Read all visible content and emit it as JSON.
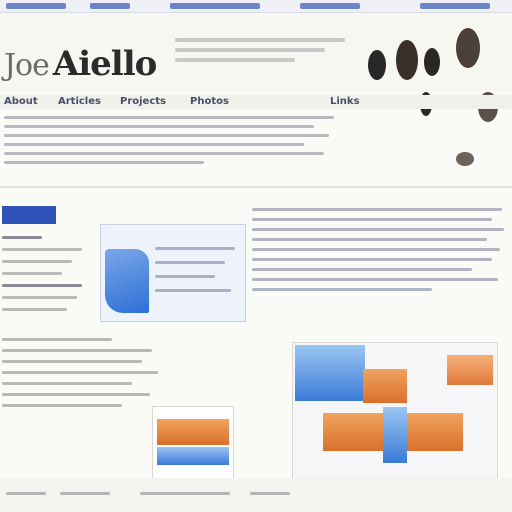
{
  "page": {
    "title_first": "Joe",
    "title_second": "Aiello",
    "tagline": "",
    "nav": [
      "About",
      "Articles",
      "Projects",
      "Photos",
      "Links"
    ],
    "left_tag": "",
    "article_heading": "",
    "section_heading": "",
    "colors": {
      "accent_blue": "#2f53b8",
      "nav_text": "#4a4e6a",
      "panel_orange": "#d9702c",
      "page_bg": "#fafaf6"
    }
  }
}
